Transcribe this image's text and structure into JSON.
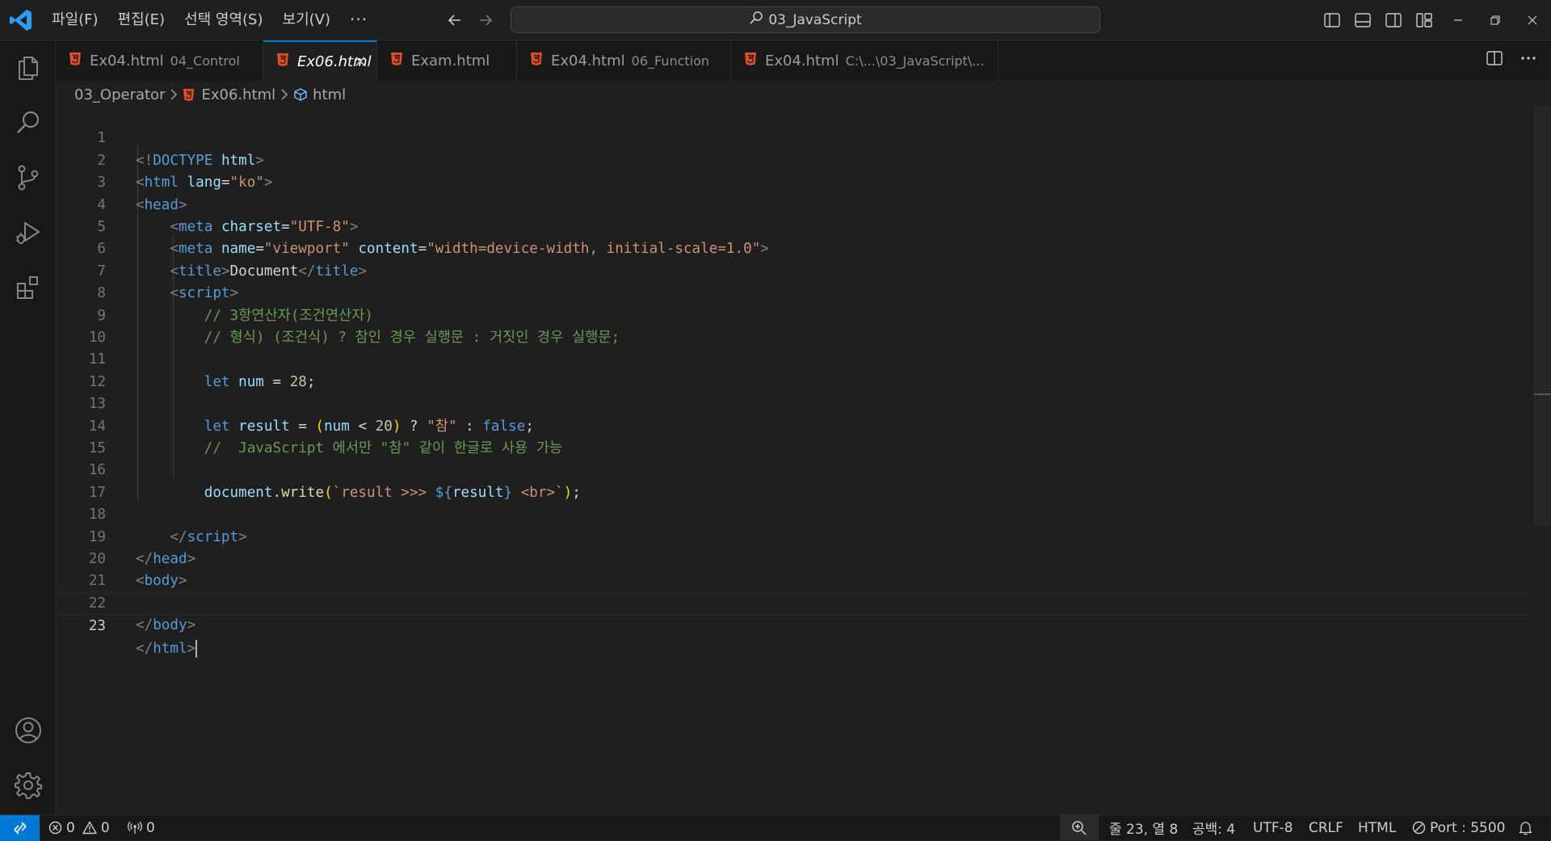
{
  "menu": [
    "파일(F)",
    "편집(E)",
    "선택 영역(S)",
    "보기(V)"
  ],
  "menu_more": "···",
  "command_center": {
    "label": "03_JavaScript"
  },
  "tabs": [
    {
      "file": "Ex04.html",
      "desc": "04_Control",
      "active": false
    },
    {
      "file": "Ex06.html",
      "desc": "",
      "active": true
    },
    {
      "file": "Exam.html",
      "desc": "",
      "active": false
    },
    {
      "file": "Ex04.html",
      "desc": "06_Function",
      "active": false
    },
    {
      "file": "Ex04.html",
      "desc": "C:\\...\\03_JavaScript\\...",
      "active": false
    }
  ],
  "tab_close_glyph": "✕",
  "breadcrumb": {
    "folder": "03_Operator",
    "file": "Ex06.html",
    "symbol": "html"
  },
  "editor": {
    "line_numbers": [
      "1",
      "2",
      "3",
      "4",
      "5",
      "6",
      "7",
      "8",
      "9",
      "10",
      "11",
      "12",
      "13",
      "14",
      "15",
      "16",
      "17",
      "18",
      "19",
      "20",
      "21",
      "22",
      "23"
    ],
    "current_line": "23"
  },
  "status": {
    "errors": "0",
    "warnings": "0",
    "ports": "0",
    "position": "줄 23, 열 8",
    "spaces": "공백: 4",
    "encoding": "UTF-8",
    "eol": "CRLF",
    "language": "HTML",
    "port": "Port : 5500"
  },
  "colors": {
    "accent": "#0078d4",
    "html_icon": "#e44d26",
    "background": "#1f1f1f"
  },
  "icons": [
    "vscode-logo-icon",
    "back-arrow-icon",
    "forward-arrow-icon",
    "search-icon",
    "toggle-primary-sidebar-icon",
    "toggle-panel-icon",
    "toggle-secondary-sidebar-icon",
    "customize-layout-icon",
    "minimize-icon",
    "restore-icon",
    "close-icon",
    "explorer-icon",
    "search-view-icon",
    "source-control-icon",
    "run-debug-icon",
    "extensions-icon",
    "accounts-icon",
    "manage-gear-icon",
    "html5-file-icon",
    "split-editor-icon",
    "more-actions-icon",
    "remote-icon",
    "error-icon",
    "warning-icon",
    "broadcast-icon",
    "zoom-icon",
    "port-icon",
    "bell-icon",
    "chevron-right-icon",
    "symbol-field-icon"
  ]
}
